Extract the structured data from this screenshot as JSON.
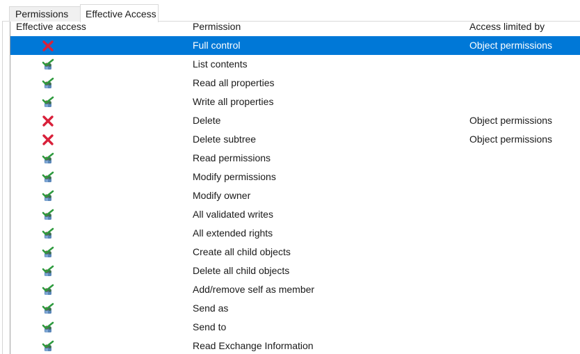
{
  "tabs": [
    {
      "label": "Permissions",
      "active": false
    },
    {
      "label": "Effective Access",
      "active": true
    }
  ],
  "columns": {
    "effective_access": "Effective access",
    "permission": "Permission",
    "access_limited_by": "Access limited by"
  },
  "icons": {
    "allowed": "allowed-check-user-icon",
    "denied": "denied-x-icon"
  },
  "colors": {
    "selection": "#0078d7",
    "denied": "#d9203a",
    "allowed_check": "#2e9b3e"
  },
  "rows": [
    {
      "access": "denied",
      "permission": "Full control",
      "limited_by": "Object permissions",
      "selected": true
    },
    {
      "access": "allowed",
      "permission": "List contents",
      "limited_by": "",
      "selected": false
    },
    {
      "access": "allowed",
      "permission": "Read all properties",
      "limited_by": "",
      "selected": false
    },
    {
      "access": "allowed",
      "permission": "Write all properties",
      "limited_by": "",
      "selected": false
    },
    {
      "access": "denied",
      "permission": "Delete",
      "limited_by": "Object permissions",
      "selected": false
    },
    {
      "access": "denied",
      "permission": "Delete subtree",
      "limited_by": "Object permissions",
      "selected": false
    },
    {
      "access": "allowed",
      "permission": "Read permissions",
      "limited_by": "",
      "selected": false
    },
    {
      "access": "allowed",
      "permission": "Modify permissions",
      "limited_by": "",
      "selected": false
    },
    {
      "access": "allowed",
      "permission": "Modify owner",
      "limited_by": "",
      "selected": false
    },
    {
      "access": "allowed",
      "permission": "All validated writes",
      "limited_by": "",
      "selected": false
    },
    {
      "access": "allowed",
      "permission": "All extended rights",
      "limited_by": "",
      "selected": false
    },
    {
      "access": "allowed",
      "permission": "Create all child objects",
      "limited_by": "",
      "selected": false
    },
    {
      "access": "allowed",
      "permission": "Delete all child objects",
      "limited_by": "",
      "selected": false
    },
    {
      "access": "allowed",
      "permission": "Add/remove self as member",
      "limited_by": "",
      "selected": false
    },
    {
      "access": "allowed",
      "permission": "Send as",
      "limited_by": "",
      "selected": false
    },
    {
      "access": "allowed",
      "permission": "Send to",
      "limited_by": "",
      "selected": false
    },
    {
      "access": "allowed",
      "permission": "Read Exchange Information",
      "limited_by": "",
      "selected": false
    }
  ]
}
